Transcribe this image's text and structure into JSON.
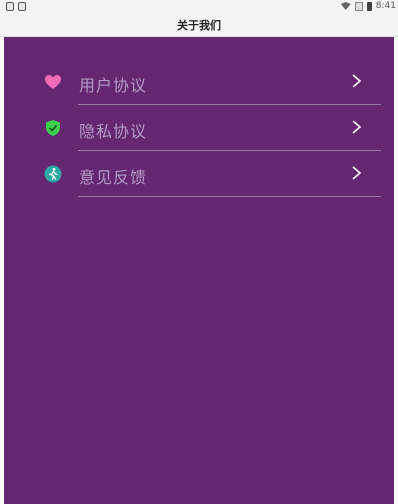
{
  "status_bar": {
    "time": "8:41"
  },
  "header": {
    "title": "关于我们"
  },
  "menu": {
    "items": [
      {
        "label": "用户协议",
        "icon": "heart-icon",
        "icon_color": "#f06ab8"
      },
      {
        "label": "隐私协议",
        "icon": "shield-check-icon",
        "icon_color": "#3ccf4e"
      },
      {
        "label": "意见反馈",
        "icon": "walking-person-icon",
        "icon_color": "#2ba8a8"
      }
    ]
  },
  "colors": {
    "background": "#652771",
    "label": "#b59ac6",
    "divider": "#9b79aa",
    "header_bg": "#f4f4f4"
  }
}
